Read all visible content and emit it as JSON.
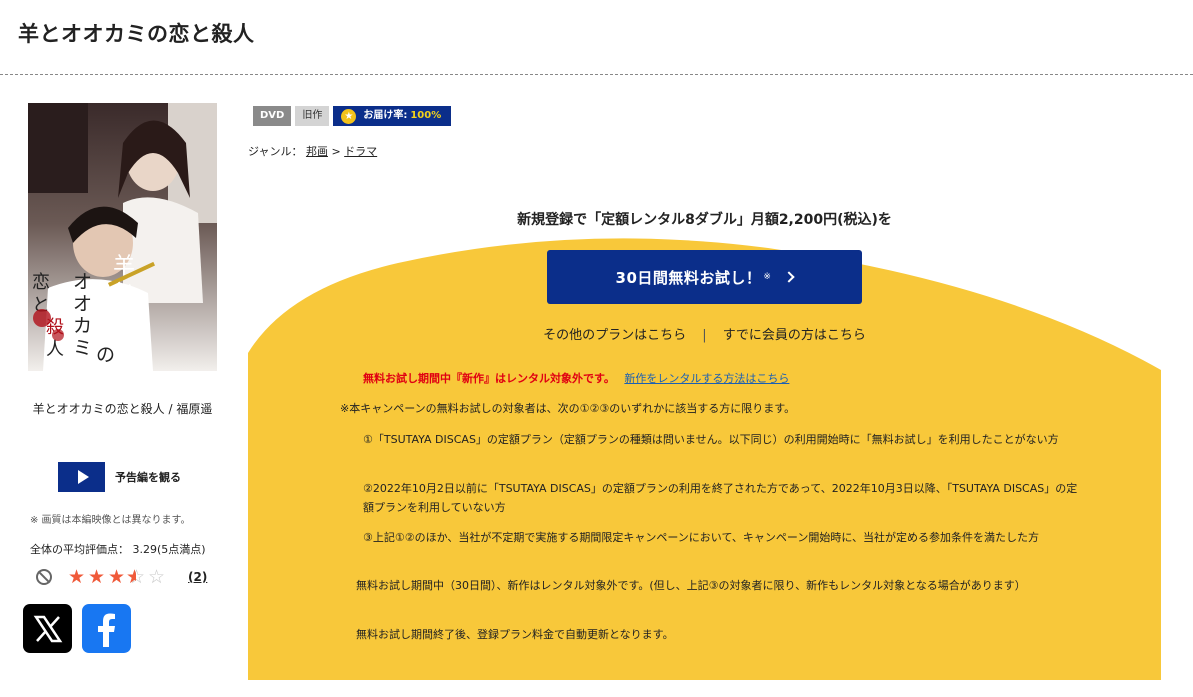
{
  "page": {
    "title": "羊とオオカミの恋と殺人"
  },
  "product": {
    "name_line": "羊とオオカミの恋と殺人 / 福原遥",
    "trailer_label": "予告編を観る",
    "quality_note": "※ 画質は本編映像とは異なります。",
    "avg_rating_text": "全体の平均評価点： 3.29(5点満点)",
    "rating_value": 3.29,
    "review_count": "(2)"
  },
  "tags": {
    "format": "DVD",
    "status": "旧作",
    "delivery_label": "お届け率:",
    "delivery_rate": "100%"
  },
  "genre": {
    "label": "ジャンル：",
    "items": [
      "邦画",
      "ドラマ"
    ],
    "separator": ">"
  },
  "campaign": {
    "headline": "新規登録で「定額レンタル8ダブル」月額2,200円(税込)を",
    "cta_label": "30日間無料お試し！",
    "cta_mark": "※",
    "link_other_plans": "その他のプランはこちら",
    "link_separator": "|",
    "link_member": "すでに会員の方はこちら",
    "notice_red": "無料お試し期間中『新作』はレンタル対象外です。",
    "notice_link": "新作をレンタルする方法はこちら",
    "line1": "※本キャンペーンの無料お試しの対象者は、次の①②③のいずれかに該当する方に限ります。",
    "line2": "①「TSUTAYA DISCAS」の定額プラン（定額プランの種類は問いません。以下同じ）の利用開始時に「無料お試し」を利用したことがない方",
    "line3": "②2022年10月2日以前に「TSUTAYA DISCAS」の定額プランの利用を終了された方であって、2022年10月3日以降、「TSUTAYA DISCAS」の定額プランを利用していない方",
    "line4": "③上記①②のほか、当社が不定期で実施する期間限定キャンペーンにおいて、キャンペーン開始時に、当社が定める参加条件を満たした方",
    "line5": "無料お試し期間中（30日間）、新作はレンタル対象外です。(但し、上記③の対象者に限り、新作もレンタル対象となる場合があります）",
    "line6": "無料お試し期間終了後、登録プラン料金で自動更新となります。"
  },
  "poster": {
    "title_text": "羊とオオカミの恋と殺人"
  },
  "colors": {
    "brand_navy": "#0b2e8a",
    "campaign_yellow": "#f8c83a",
    "star_red": "#f05a3a",
    "notice_red": "#e00012"
  }
}
